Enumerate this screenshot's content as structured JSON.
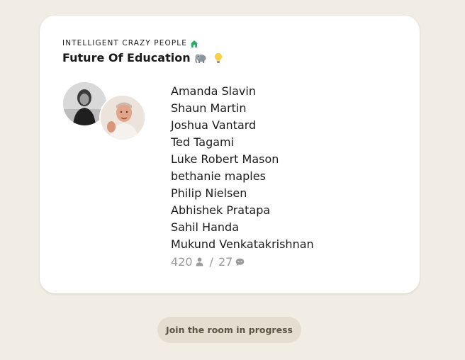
{
  "room": {
    "club_name": "INTELLIGENT CRAZY PEOPLE",
    "club_icon": "house-icon",
    "title": "Future Of Education",
    "title_emojis": [
      "elephant-icon",
      "lightbulb-icon"
    ],
    "speakers": [
      "Amanda Slavin",
      "Shaun Martin",
      "Joshua Vantard",
      "Ted Tagami",
      "Luke Robert Mason",
      "bethanie maples",
      "Philip Nielsen",
      "Abhishek Pratapa",
      "Sahil Handa",
      "Mukund Venkatakrishnan"
    ],
    "listener_count": "420",
    "separator": "/",
    "speaker_count": "27"
  },
  "join_button": {
    "label": "Join the room in progress"
  },
  "colors": {
    "background": "#f1ede4",
    "card": "#ffffff",
    "club_icon": "#27ae60",
    "button_bg": "#e5ded0",
    "button_text": "#5b5445",
    "muted_text": "#9a9a9a"
  }
}
